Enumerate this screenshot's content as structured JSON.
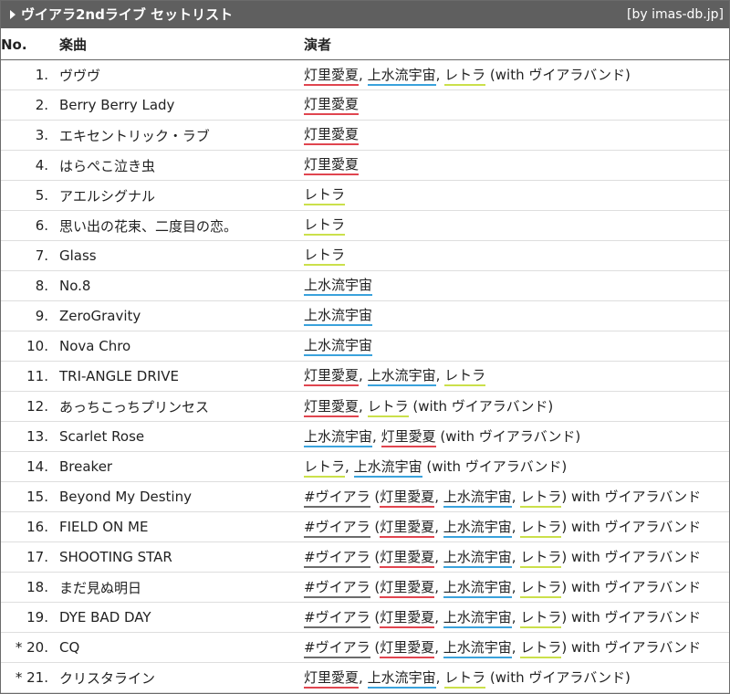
{
  "header": {
    "title": "ヴイアラ2ndライブ セットリスト",
    "source": "[by imas-db.jp]"
  },
  "columns": {
    "no": "No.",
    "song": "楽曲",
    "performer": "演者"
  },
  "colors": {
    "akari": "#e0454f",
    "minase": "#3aa2dc",
    "letora": "#cbe04b",
    "unit": "#6b6b6b"
  },
  "rows": [
    {
      "no": "1.",
      "song": "ヴヴヴ",
      "performers": [
        {
          "t": "灯里愛夏",
          "c": "red"
        },
        {
          "t": ", "
        },
        {
          "t": "上水流宇宙",
          "c": "blue"
        },
        {
          "t": ", "
        },
        {
          "t": "レトラ",
          "c": "yellow"
        },
        {
          "t": " (with ヴイアラバンド)"
        }
      ]
    },
    {
      "no": "2.",
      "song": "Berry Berry Lady",
      "performers": [
        {
          "t": "灯里愛夏",
          "c": "red"
        }
      ]
    },
    {
      "no": "3.",
      "song": "エキセントリック・ラブ",
      "performers": [
        {
          "t": "灯里愛夏",
          "c": "red"
        }
      ]
    },
    {
      "no": "4.",
      "song": "はらぺこ泣き虫",
      "performers": [
        {
          "t": "灯里愛夏",
          "c": "red"
        }
      ]
    },
    {
      "no": "5.",
      "song": "アエルシグナル",
      "performers": [
        {
          "t": "レトラ",
          "c": "yellow"
        }
      ]
    },
    {
      "no": "6.",
      "song": "思い出の花束、二度目の恋。",
      "performers": [
        {
          "t": "レトラ",
          "c": "yellow"
        }
      ]
    },
    {
      "no": "7.",
      "song": "Glass",
      "performers": [
        {
          "t": "レトラ",
          "c": "yellow"
        }
      ]
    },
    {
      "no": "8.",
      "song": "No.8",
      "performers": [
        {
          "t": "上水流宇宙",
          "c": "blue"
        }
      ]
    },
    {
      "no": "9.",
      "song": "ZeroGravity",
      "performers": [
        {
          "t": "上水流宇宙",
          "c": "blue"
        }
      ]
    },
    {
      "no": "10.",
      "song": "Nova Chro",
      "performers": [
        {
          "t": "上水流宇宙",
          "c": "blue"
        }
      ]
    },
    {
      "no": "11.",
      "song": "TRI-ANGLE DRIVE",
      "performers": [
        {
          "t": "灯里愛夏",
          "c": "red"
        },
        {
          "t": ", "
        },
        {
          "t": "上水流宇宙",
          "c": "blue"
        },
        {
          "t": ", "
        },
        {
          "t": "レトラ",
          "c": "yellow"
        }
      ]
    },
    {
      "no": "12.",
      "song": "あっちこっちプリンセス",
      "performers": [
        {
          "t": "灯里愛夏",
          "c": "red"
        },
        {
          "t": ", "
        },
        {
          "t": "レトラ",
          "c": "yellow"
        },
        {
          "t": " (with ヴイアラバンド)"
        }
      ]
    },
    {
      "no": "13.",
      "song": "Scarlet Rose",
      "performers": [
        {
          "t": "上水流宇宙",
          "c": "blue"
        },
        {
          "t": ", "
        },
        {
          "t": "灯里愛夏",
          "c": "red"
        },
        {
          "t": " (with ヴイアラバンド)"
        }
      ]
    },
    {
      "no": "14.",
      "song": "Breaker",
      "performers": [
        {
          "t": "レトラ",
          "c": "yellow"
        },
        {
          "t": ", "
        },
        {
          "t": "上水流宇宙",
          "c": "blue"
        },
        {
          "t": " (with ヴイアラバンド)"
        }
      ]
    },
    {
      "no": "15.",
      "song": "Beyond My Destiny",
      "performers": [
        {
          "t": "#ヴイアラ",
          "c": "gray"
        },
        {
          "t": " ("
        },
        {
          "t": "灯里愛夏",
          "c": "red"
        },
        {
          "t": ", "
        },
        {
          "t": "上水流宇宙",
          "c": "blue"
        },
        {
          "t": ", "
        },
        {
          "t": "レトラ",
          "c": "yellow"
        },
        {
          "t": ") with ヴイアラバンド"
        }
      ]
    },
    {
      "no": "16.",
      "song": "FIELD ON ME",
      "performers": [
        {
          "t": "#ヴイアラ",
          "c": "gray"
        },
        {
          "t": " ("
        },
        {
          "t": "灯里愛夏",
          "c": "red"
        },
        {
          "t": ", "
        },
        {
          "t": "上水流宇宙",
          "c": "blue"
        },
        {
          "t": ", "
        },
        {
          "t": "レトラ",
          "c": "yellow"
        },
        {
          "t": ") with ヴイアラバンド"
        }
      ]
    },
    {
      "no": "17.",
      "song": "SHOOTING STAR",
      "performers": [
        {
          "t": "#ヴイアラ",
          "c": "gray"
        },
        {
          "t": " ("
        },
        {
          "t": "灯里愛夏",
          "c": "red"
        },
        {
          "t": ", "
        },
        {
          "t": "上水流宇宙",
          "c": "blue"
        },
        {
          "t": ", "
        },
        {
          "t": "レトラ",
          "c": "yellow"
        },
        {
          "t": ") with ヴイアラバンド"
        }
      ]
    },
    {
      "no": "18.",
      "song": "まだ見ぬ明日",
      "performers": [
        {
          "t": "#ヴイアラ",
          "c": "gray"
        },
        {
          "t": " ("
        },
        {
          "t": "灯里愛夏",
          "c": "red"
        },
        {
          "t": ", "
        },
        {
          "t": "上水流宇宙",
          "c": "blue"
        },
        {
          "t": ", "
        },
        {
          "t": "レトラ",
          "c": "yellow"
        },
        {
          "t": ") with ヴイアラバンド"
        }
      ]
    },
    {
      "no": "19.",
      "song": "DYE BAD DAY",
      "performers": [
        {
          "t": "#ヴイアラ",
          "c": "gray"
        },
        {
          "t": " ("
        },
        {
          "t": "灯里愛夏",
          "c": "red"
        },
        {
          "t": ", "
        },
        {
          "t": "上水流宇宙",
          "c": "blue"
        },
        {
          "t": ", "
        },
        {
          "t": "レトラ",
          "c": "yellow"
        },
        {
          "t": ") with ヴイアラバンド"
        }
      ]
    },
    {
      "no": "* 20.",
      "song": "CQ",
      "performers": [
        {
          "t": "#ヴイアラ",
          "c": "gray"
        },
        {
          "t": " ("
        },
        {
          "t": "灯里愛夏",
          "c": "red"
        },
        {
          "t": ", "
        },
        {
          "t": "上水流宇宙",
          "c": "blue"
        },
        {
          "t": ", "
        },
        {
          "t": "レトラ",
          "c": "yellow"
        },
        {
          "t": ") with ヴイアラバンド"
        }
      ]
    },
    {
      "no": "* 21.",
      "song": "クリスタライン",
      "performers": [
        {
          "t": "灯里愛夏",
          "c": "red"
        },
        {
          "t": ", "
        },
        {
          "t": "上水流宇宙",
          "c": "blue"
        },
        {
          "t": ", "
        },
        {
          "t": "レトラ",
          "c": "yellow"
        },
        {
          "t": " (with ヴイアラバンド)"
        }
      ]
    }
  ]
}
